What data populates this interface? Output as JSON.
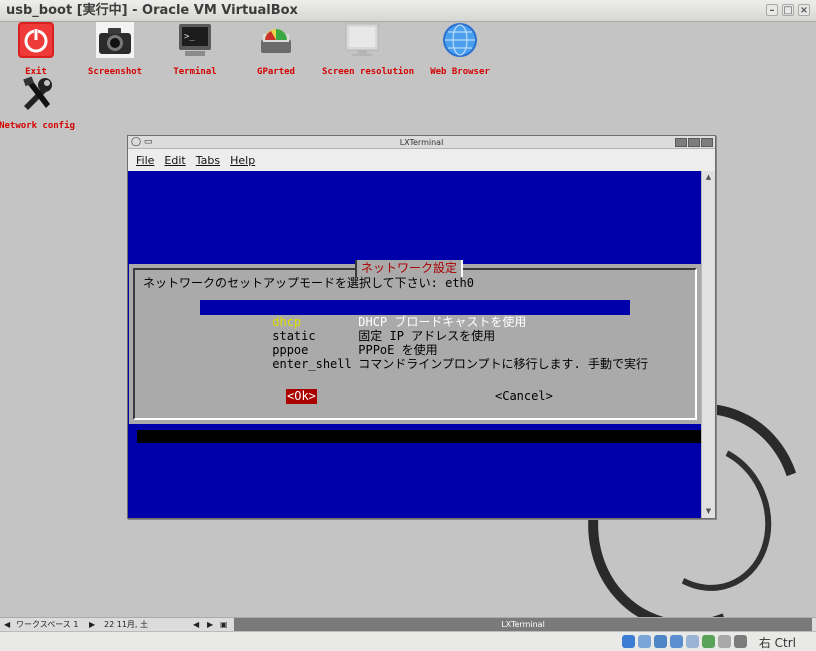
{
  "window": {
    "title": "usb_boot [実行中] - Oracle VM VirtualBox"
  },
  "desktop": {
    "icons": [
      {
        "label": "Exit",
        "icon": "power-icon"
      },
      {
        "label": "Screenshot",
        "icon": "camera-icon"
      },
      {
        "label": "Terminal",
        "icon": "terminal-icon"
      },
      {
        "label": "GParted",
        "icon": "gparted-icon"
      },
      {
        "label": "Screen resolution",
        "icon": "monitor-icon"
      },
      {
        "label": "Web Browser",
        "icon": "globe-icon"
      },
      {
        "label": "Network config",
        "icon": "tools-icon"
      }
    ]
  },
  "terminal": {
    "title": "LXTerminal",
    "menu": [
      "File",
      "Edit",
      "Tabs",
      "Help"
    ],
    "dialog": {
      "title": "ネットワーク設定",
      "prompt": "ネットワークのセットアップモードを選択して下さい: eth0",
      "options": [
        {
          "tag": "dhcp",
          "desc": "DHCP ブロードキャストを使用",
          "selected": true
        },
        {
          "tag": "static",
          "desc": "固定 IP アドレスを使用",
          "selected": false
        },
        {
          "tag": "pppoe",
          "desc": "PPPoE を使用",
          "selected": false
        },
        {
          "tag": "enter_shell",
          "desc": "コマンドラインプロンプトに移行します. 手動で実行",
          "selected": false
        }
      ],
      "ok_label": "<Ok>",
      "cancel_label": "<Cancel>"
    }
  },
  "taskbar": {
    "workspace": "ワークスペース 1",
    "date": "22 11月, 土",
    "task": "LXTerminal"
  },
  "statusbar": {
    "host_key": "右 Ctrl"
  },
  "colors": {
    "console_blue": "#0000aa",
    "dialog_gray": "#aaaaaa",
    "accent_red": "#aa0000"
  }
}
